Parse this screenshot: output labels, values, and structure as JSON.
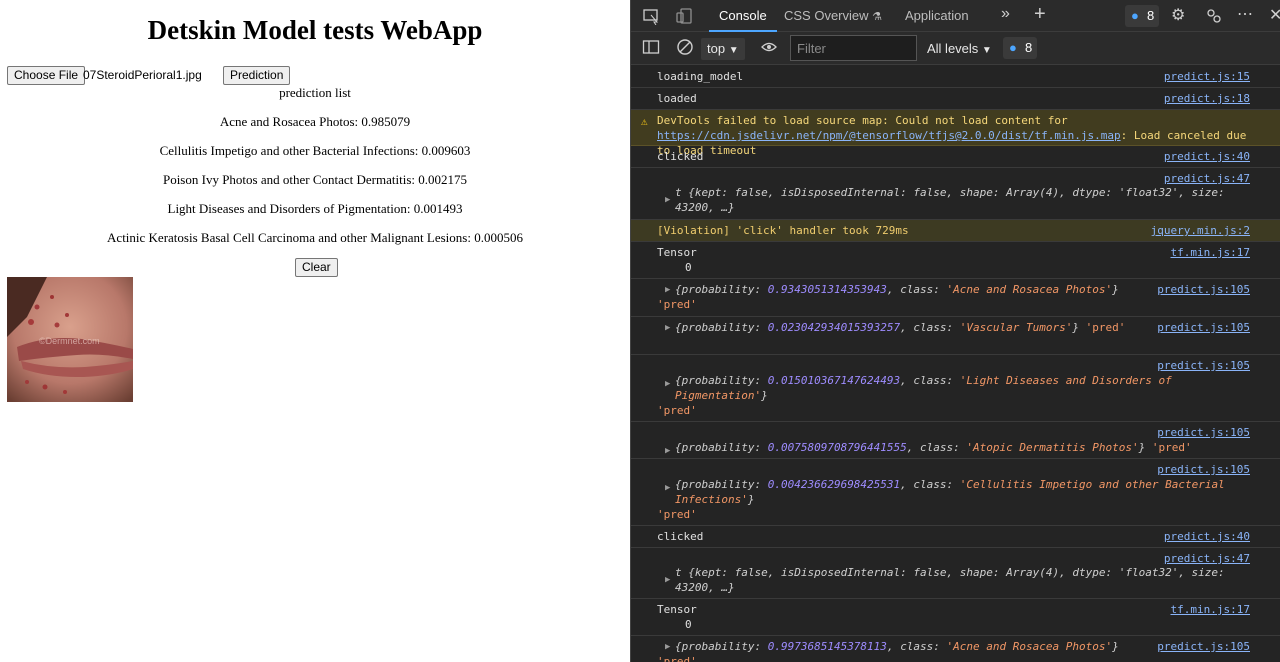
{
  "app": {
    "title": "Detskin Model tests WebApp",
    "choose_file_label": "Choose File",
    "file_name": "07SteroidPerioral1.jpg",
    "prediction_label": "Prediction",
    "prediction_list_title": "prediction list",
    "predictions": [
      "Acne and Rosacea Photos: 0.985079",
      "Cellulitis Impetigo and other Bacterial Infections: 0.009603",
      "Poison Ivy Photos and other Contact Dermatitis: 0.002175",
      "Light Diseases and Disorders of Pigmentation: 0.001493",
      "Actinic Keratosis Basal Cell Carcinoma and other Malignant Lesions: 0.000506"
    ],
    "clear_label": "Clear",
    "image_watermark": "©Dermnet.com"
  },
  "devtools": {
    "tabs": [
      "Console",
      "CSS Overview",
      "Application"
    ],
    "issues_count": "8",
    "context": "top",
    "filter_placeholder": "Filter",
    "levels": "All levels",
    "toolbar_issues_count": "8",
    "logs": {
      "loading_model": "loading_model",
      "loaded": "loaded",
      "warn_text": "DevTools failed to load source map: Could not load content for ",
      "warn_url": "https://cdn.jsdelivr.net/npm/@tensorflow/tfjs@2.0.0/dist/tf.min.js.map",
      "warn_tail": ": Load canceled due to load timeout",
      "clicked": "clicked",
      "tensor_obj": "t {kept: false, isDisposedInternal: false, shape: Array(4), dtype: 'float32', size: 43200, …}",
      "violation": "[Violation] 'click' handler took 729ms",
      "tensor_label": "Tensor",
      "tensor_value": "0",
      "pred_suffix": "'pred'",
      "preds1": [
        {
          "probability": "0.9343051314353943",
          "class": "'Acne and Rosacea Photos'"
        },
        {
          "probability": "0.023042934015393257",
          "class": "'Vascular Tumors'"
        },
        {
          "probability": "0.015010367147624493",
          "class": "'Light Diseases and Disorders of Pigmentation'"
        },
        {
          "probability": "0.0075809708796441555",
          "class": "'Atopic Dermatitis Photos'"
        },
        {
          "probability": "0.004236629698425531",
          "class": "'Cellulitis Impetigo and other Bacterial Infections'"
        }
      ],
      "last_pred": {
        "probability": "0.9973685145378113",
        "class": "'Acne and Rosacea Photos'"
      }
    },
    "sources": {
      "p15": "predict.js:15",
      "p18": "predict.js:18",
      "p40": "predict.js:40",
      "p47": "predict.js:47",
      "jq": "jquery.min.js:2",
      "tf": "tf.min.js:17",
      "p105": "predict.js:105"
    }
  }
}
